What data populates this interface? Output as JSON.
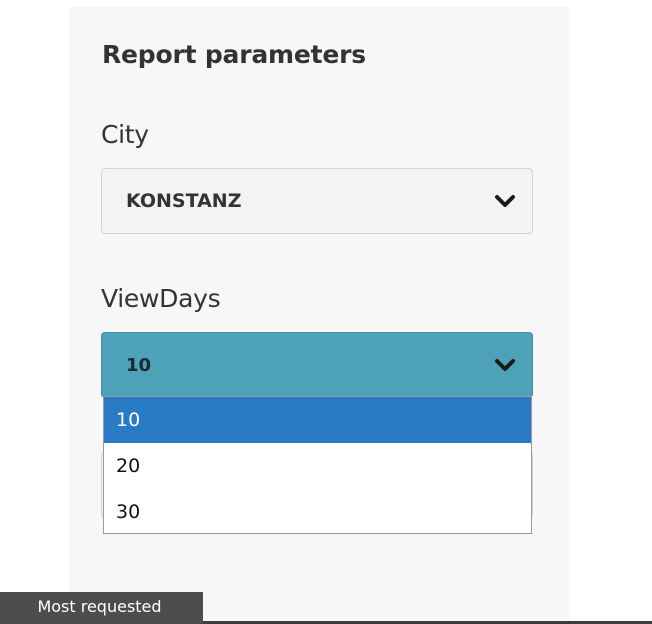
{
  "panel": {
    "title": "Report parameters",
    "fields": [
      {
        "label": "City",
        "selected_value": "KONSTANZ",
        "icon": "chevron-down-icon"
      },
      {
        "label": "ViewDays",
        "selected_value": "10",
        "icon": "chevron-down-icon",
        "expanded": true,
        "options": [
          "10",
          "20",
          "30"
        ],
        "highlighted_option": "10"
      }
    ]
  },
  "status_bar": {
    "tab_label": "Most requested"
  },
  "colors": {
    "panel_bg": "#f7f7f7",
    "city_select_bg": "#f2f3f3",
    "active_select_bg": "#4da1b8",
    "option_highlight": "#2a7bc5",
    "status_tab_bg": "#4d4d4d"
  }
}
